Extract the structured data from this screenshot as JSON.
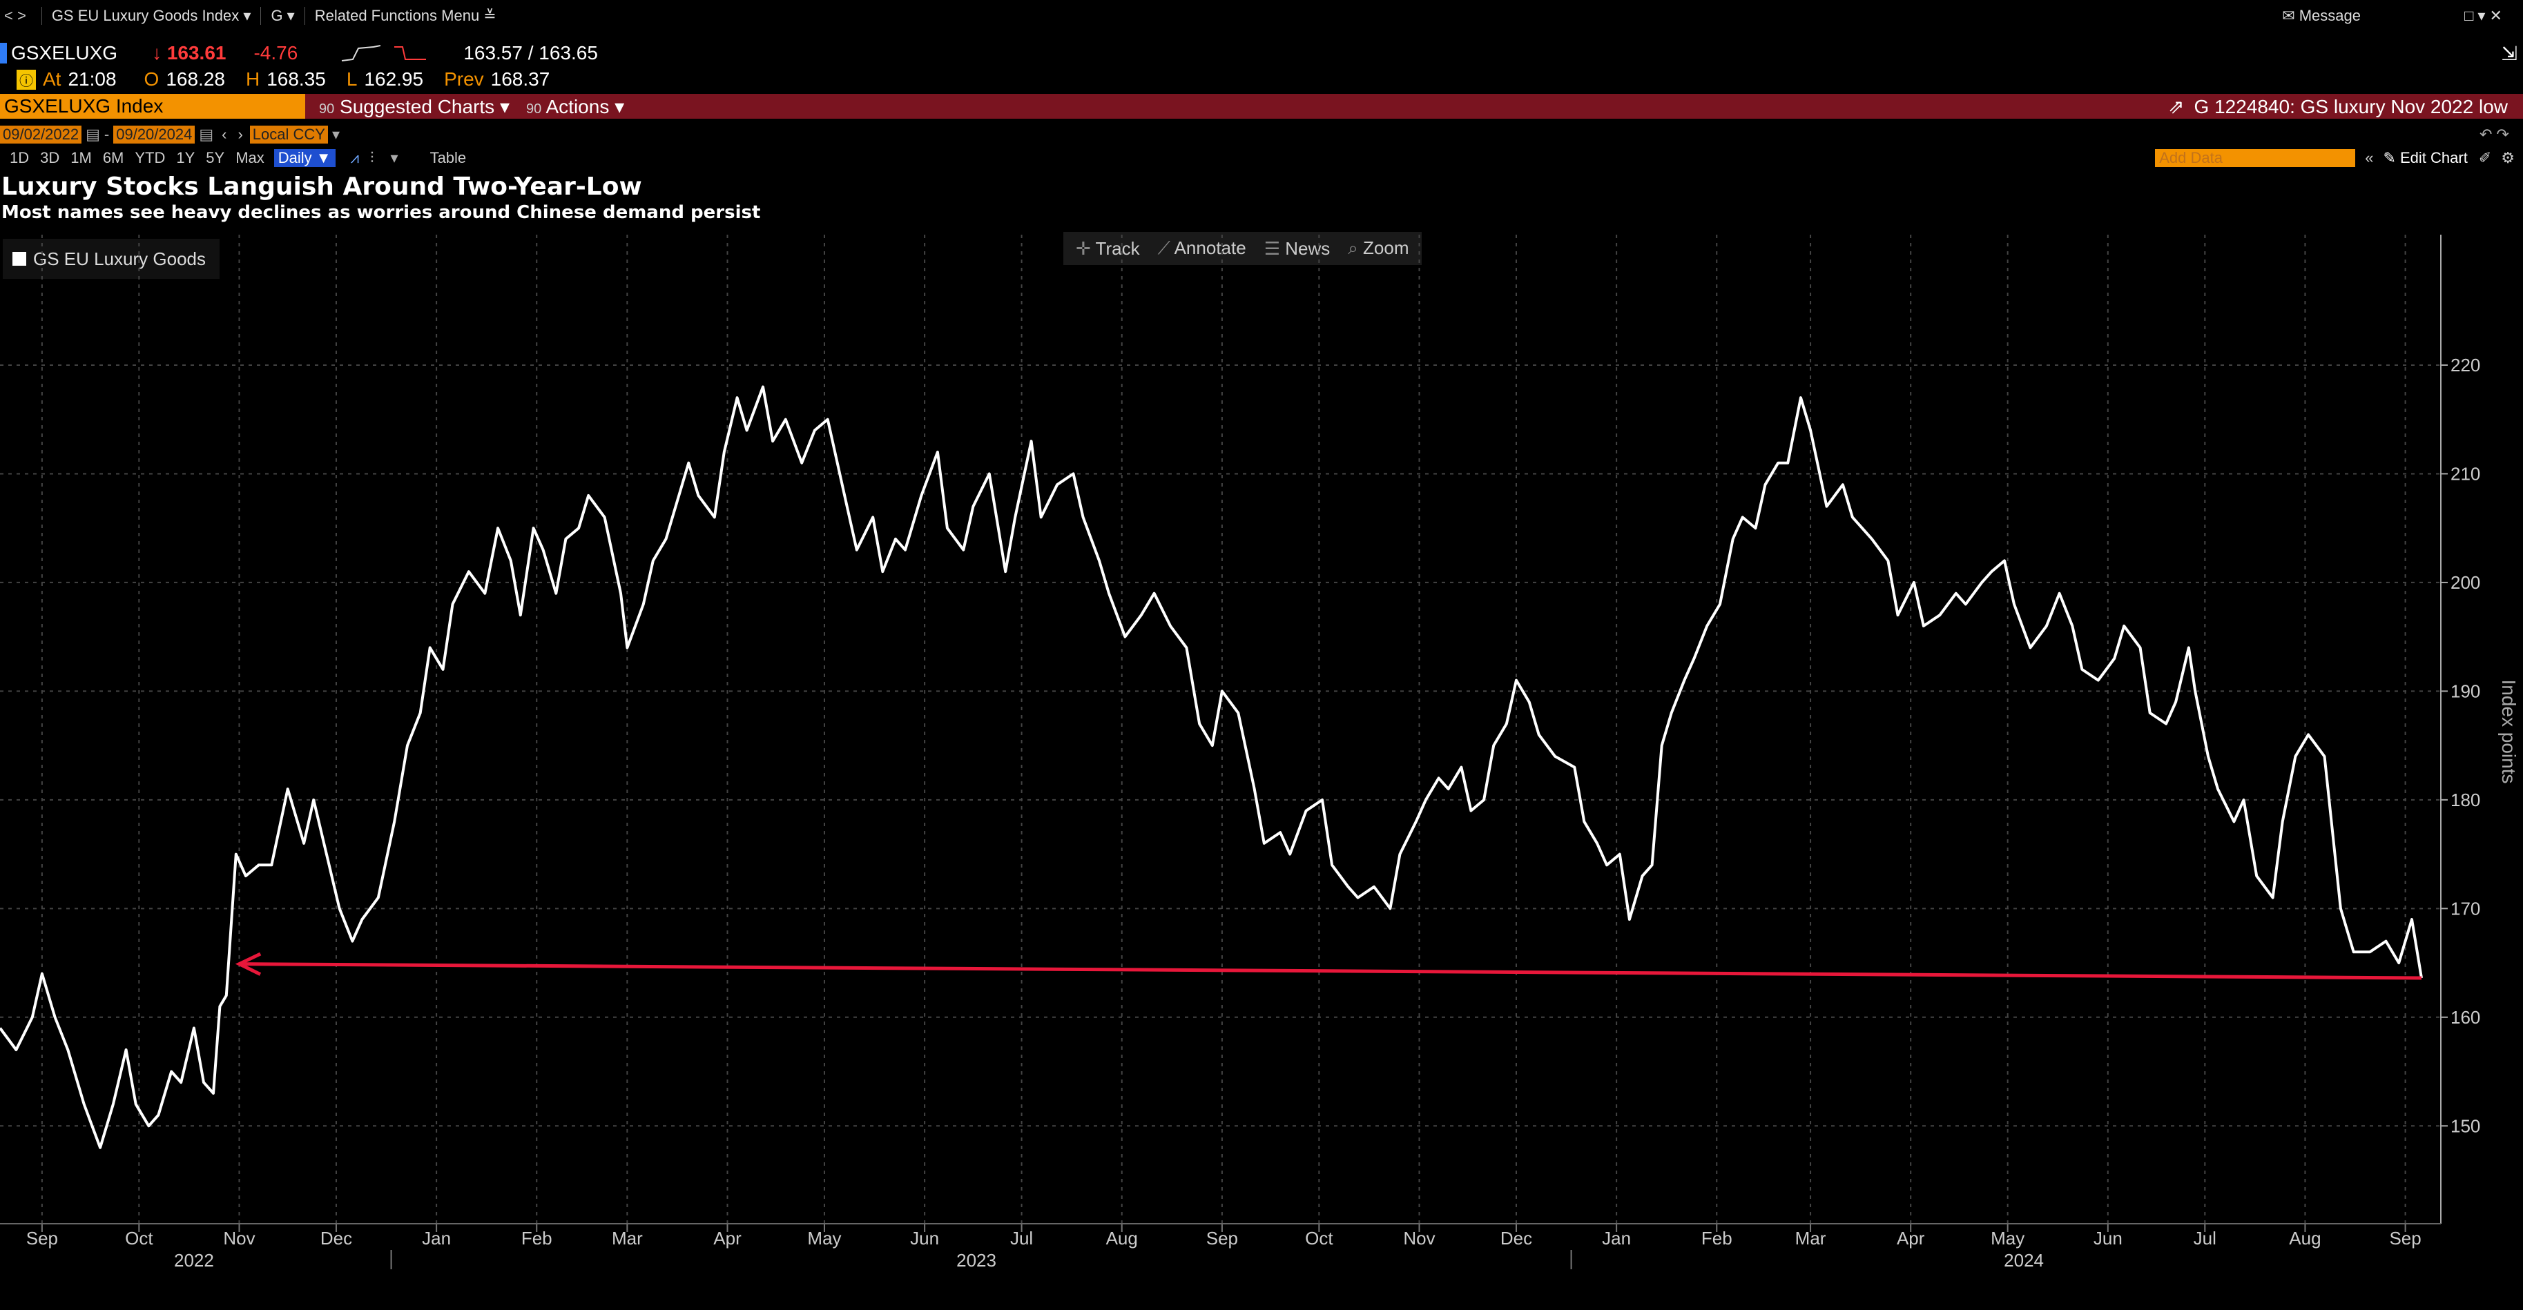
{
  "topbar": {
    "nav": "< >",
    "security": "GS EU Luxury Goods Index ▾",
    "g": "G ▾",
    "related": "Related Functions Menu ≚",
    "message": "Message"
  },
  "quote": {
    "ticker": "GSXELUXG",
    "last": "↓ 163.61",
    "change": "-4.76",
    "bid_ask": "163.57 / 163.65",
    "at_label": "At",
    "time": "21:08",
    "open_label": "O",
    "open": "168.28",
    "high_label": "H",
    "high": "168.35",
    "low_label": "L",
    "low": "162.95",
    "prev_label": "Prev",
    "prev": "168.37"
  },
  "commandbar": {
    "index": "GSXELUXG Index",
    "suggested": "Suggested Charts ▾",
    "actions": "Actions ▾",
    "note": "G 1224840: GS luxury Nov 2022 low"
  },
  "daterow": {
    "start": "09/02/2022",
    "end": "09/20/2024",
    "ccy": "Local CCY"
  },
  "periods": [
    "1D",
    "3D",
    "1M",
    "6M",
    "YTD",
    "1Y",
    "5Y",
    "Max"
  ],
  "period_selected": "Daily ▼",
  "table_label": "Table",
  "add_data": "Add Data",
  "edit_chart": "Edit Chart",
  "tools": {
    "track": "Track",
    "annotate": "Annotate",
    "news": "News",
    "zoom": "Zoom"
  },
  "colors": {
    "line": "#ffffff",
    "arrow": "#e8173a",
    "background": "#000000",
    "cmdbar": "#7a1420",
    "accent": "#f39200"
  },
  "chart_data": {
    "type": "line",
    "title": "Luxury Stocks Languish Around Two-Year-Low",
    "subtitle": "Most names see heavy declines as worries around Chinese demand persist",
    "ylabel": "Index points",
    "ylim": [
      141,
      232
    ],
    "yticks": [
      150,
      160,
      170,
      180,
      190,
      200,
      210,
      220
    ],
    "legend_position": "top-left",
    "grid": true,
    "x_range": [
      "2022-09-02",
      "2024-09-20"
    ],
    "month_ticks": [
      {
        "date": "2022-09-15",
        "label": "Sep"
      },
      {
        "date": "2022-10-15",
        "label": "Oct"
      },
      {
        "date": "2022-11-15",
        "label": "Nov"
      },
      {
        "date": "2022-12-15",
        "label": "Dec"
      },
      {
        "date": "2023-01-15",
        "label": "Jan"
      },
      {
        "date": "2023-02-15",
        "label": "Feb"
      },
      {
        "date": "2023-03-15",
        "label": "Mar"
      },
      {
        "date": "2023-04-15",
        "label": "Apr"
      },
      {
        "date": "2023-05-15",
        "label": "May"
      },
      {
        "date": "2023-06-15",
        "label": "Jun"
      },
      {
        "date": "2023-07-15",
        "label": "Jul"
      },
      {
        "date": "2023-08-15",
        "label": "Aug"
      },
      {
        "date": "2023-09-15",
        "label": "Sep"
      },
      {
        "date": "2023-10-15",
        "label": "Oct"
      },
      {
        "date": "2023-11-15",
        "label": "Nov"
      },
      {
        "date": "2023-12-15",
        "label": "Dec"
      },
      {
        "date": "2024-01-15",
        "label": "Jan"
      },
      {
        "date": "2024-02-15",
        "label": "Feb"
      },
      {
        "date": "2024-03-15",
        "label": "Mar"
      },
      {
        "date": "2024-04-15",
        "label": "Apr"
      },
      {
        "date": "2024-05-15",
        "label": "May"
      },
      {
        "date": "2024-06-15",
        "label": "Jun"
      },
      {
        "date": "2024-07-15",
        "label": "Jul"
      },
      {
        "date": "2024-08-15",
        "label": "Aug"
      },
      {
        "date": "2024-09-15",
        "label": "Sep"
      }
    ],
    "year_labels": [
      {
        "date": "2022-11-01",
        "label": "2022"
      },
      {
        "date": "2023-07-01",
        "label": "2023"
      },
      {
        "date": "2024-05-20",
        "label": "2024"
      }
    ],
    "series": [
      {
        "name": "GS EU Luxury Goods",
        "points": [
          [
            "2022-09-02",
            159
          ],
          [
            "2022-09-07",
            157
          ],
          [
            "2022-09-12",
            160
          ],
          [
            "2022-09-15",
            164
          ],
          [
            "2022-09-19",
            160
          ],
          [
            "2022-09-23",
            157
          ],
          [
            "2022-09-28",
            152
          ],
          [
            "2022-10-03",
            148
          ],
          [
            "2022-10-07",
            152
          ],
          [
            "2022-10-11",
            157
          ],
          [
            "2022-10-14",
            152
          ],
          [
            "2022-10-18",
            150
          ],
          [
            "2022-10-21",
            151
          ],
          [
            "2022-10-25",
            155
          ],
          [
            "2022-10-28",
            154
          ],
          [
            "2022-11-01",
            159
          ],
          [
            "2022-11-04",
            154
          ],
          [
            "2022-11-07",
            153
          ],
          [
            "2022-11-09",
            161
          ],
          [
            "2022-11-11",
            162
          ],
          [
            "2022-11-14",
            175
          ],
          [
            "2022-11-17",
            173
          ],
          [
            "2022-11-21",
            174
          ],
          [
            "2022-11-25",
            174
          ],
          [
            "2022-11-30",
            181
          ],
          [
            "2022-12-05",
            176
          ],
          [
            "2022-12-08",
            180
          ],
          [
            "2022-12-12",
            175
          ],
          [
            "2022-12-16",
            170
          ],
          [
            "2022-12-20",
            167
          ],
          [
            "2022-12-23",
            169
          ],
          [
            "2022-12-28",
            171
          ],
          [
            "2023-01-02",
            178
          ],
          [
            "2023-01-06",
            185
          ],
          [
            "2023-01-10",
            188
          ],
          [
            "2023-01-13",
            194
          ],
          [
            "2023-01-17",
            192
          ],
          [
            "2023-01-20",
            198
          ],
          [
            "2023-01-25",
            201
          ],
          [
            "2023-01-30",
            199
          ],
          [
            "2023-02-03",
            205
          ],
          [
            "2023-02-07",
            202
          ],
          [
            "2023-02-10",
            197
          ],
          [
            "2023-02-14",
            205
          ],
          [
            "2023-02-17",
            203
          ],
          [
            "2023-02-21",
            199
          ],
          [
            "2023-02-24",
            204
          ],
          [
            "2023-02-28",
            205
          ],
          [
            "2023-03-03",
            208
          ],
          [
            "2023-03-08",
            206
          ],
          [
            "2023-03-13",
            199
          ],
          [
            "2023-03-15",
            194
          ],
          [
            "2023-03-20",
            198
          ],
          [
            "2023-03-23",
            202
          ],
          [
            "2023-03-27",
            204
          ],
          [
            "2023-04-03",
            211
          ],
          [
            "2023-04-06",
            208
          ],
          [
            "2023-04-11",
            206
          ],
          [
            "2023-04-14",
            212
          ],
          [
            "2023-04-18",
            217
          ],
          [
            "2023-04-21",
            214
          ],
          [
            "2023-04-26",
            218
          ],
          [
            "2023-04-29",
            213
          ],
          [
            "2023-05-03",
            215
          ],
          [
            "2023-05-08",
            211
          ],
          [
            "2023-05-12",
            214
          ],
          [
            "2023-05-16",
            215
          ],
          [
            "2023-05-19",
            211
          ],
          [
            "2023-05-22",
            207
          ],
          [
            "2023-05-25",
            203
          ],
          [
            "2023-05-30",
            206
          ],
          [
            "2023-06-02",
            201
          ],
          [
            "2023-06-06",
            204
          ],
          [
            "2023-06-09",
            203
          ],
          [
            "2023-06-14",
            208
          ],
          [
            "2023-06-19",
            212
          ],
          [
            "2023-06-22",
            205
          ],
          [
            "2023-06-27",
            203
          ],
          [
            "2023-06-30",
            207
          ],
          [
            "2023-07-05",
            210
          ],
          [
            "2023-07-10",
            201
          ],
          [
            "2023-07-13",
            206
          ],
          [
            "2023-07-18",
            213
          ],
          [
            "2023-07-21",
            206
          ],
          [
            "2023-07-26",
            209
          ],
          [
            "2023-07-31",
            210
          ],
          [
            "2023-08-03",
            206
          ],
          [
            "2023-08-08",
            202
          ],
          [
            "2023-08-11",
            199
          ],
          [
            "2023-08-16",
            195
          ],
          [
            "2023-08-21",
            197
          ],
          [
            "2023-08-25",
            199
          ],
          [
            "2023-08-30",
            196
          ],
          [
            "2023-09-04",
            194
          ],
          [
            "2023-09-08",
            187
          ],
          [
            "2023-09-12",
            185
          ],
          [
            "2023-09-15",
            190
          ],
          [
            "2023-09-20",
            188
          ],
          [
            "2023-09-25",
            181
          ],
          [
            "2023-09-28",
            176
          ],
          [
            "2023-10-03",
            177
          ],
          [
            "2023-10-06",
            175
          ],
          [
            "2023-10-11",
            179
          ],
          [
            "2023-10-16",
            180
          ],
          [
            "2023-10-19",
            174
          ],
          [
            "2023-10-24",
            172
          ],
          [
            "2023-10-27",
            171
          ],
          [
            "2023-11-01",
            172
          ],
          [
            "2023-11-06",
            170
          ],
          [
            "2023-11-09",
            175
          ],
          [
            "2023-11-14",
            178
          ],
          [
            "2023-11-17",
            180
          ],
          [
            "2023-11-21",
            182
          ],
          [
            "2023-11-24",
            181
          ],
          [
            "2023-11-28",
            183
          ],
          [
            "2023-12-01",
            179
          ],
          [
            "2023-12-05",
            180
          ],
          [
            "2023-12-08",
            185
          ],
          [
            "2023-12-12",
            187
          ],
          [
            "2023-12-15",
            191
          ],
          [
            "2023-12-19",
            189
          ],
          [
            "2023-12-22",
            186
          ],
          [
            "2023-12-27",
            184
          ],
          [
            "2024-01-02",
            183
          ],
          [
            "2024-01-05",
            178
          ],
          [
            "2024-01-09",
            176
          ],
          [
            "2024-01-12",
            174
          ],
          [
            "2024-01-16",
            175
          ],
          [
            "2024-01-19",
            169
          ],
          [
            "2024-01-23",
            173
          ],
          [
            "2024-01-26",
            174
          ],
          [
            "2024-01-29",
            185
          ],
          [
            "2024-02-01",
            188
          ],
          [
            "2024-02-05",
            191
          ],
          [
            "2024-02-08",
            193
          ],
          [
            "2024-02-12",
            196
          ],
          [
            "2024-02-16",
            198
          ],
          [
            "2024-02-20",
            204
          ],
          [
            "2024-02-23",
            206
          ],
          [
            "2024-02-27",
            205
          ],
          [
            "2024-03-01",
            209
          ],
          [
            "2024-03-05",
            211
          ],
          [
            "2024-03-08",
            211
          ],
          [
            "2024-03-12",
            217
          ],
          [
            "2024-03-15",
            214
          ],
          [
            "2024-03-20",
            207
          ],
          [
            "2024-03-25",
            209
          ],
          [
            "2024-03-28",
            206
          ],
          [
            "2024-04-03",
            204
          ],
          [
            "2024-04-08",
            202
          ],
          [
            "2024-04-11",
            197
          ],
          [
            "2024-04-16",
            200
          ],
          [
            "2024-04-19",
            196
          ],
          [
            "2024-04-24",
            197
          ],
          [
            "2024-04-29",
            199
          ],
          [
            "2024-05-02",
            198
          ],
          [
            "2024-05-07",
            200
          ],
          [
            "2024-05-10",
            201
          ],
          [
            "2024-05-14",
            202
          ],
          [
            "2024-05-17",
            198
          ],
          [
            "2024-05-22",
            194
          ],
          [
            "2024-05-27",
            196
          ],
          [
            "2024-05-31",
            199
          ],
          [
            "2024-06-04",
            196
          ],
          [
            "2024-06-07",
            192
          ],
          [
            "2024-06-12",
            191
          ],
          [
            "2024-06-17",
            193
          ],
          [
            "2024-06-20",
            196
          ],
          [
            "2024-06-25",
            194
          ],
          [
            "2024-06-28",
            188
          ],
          [
            "2024-07-03",
            187
          ],
          [
            "2024-07-06",
            189
          ],
          [
            "2024-07-10",
            194
          ],
          [
            "2024-07-12",
            190
          ],
          [
            "2024-07-16",
            184
          ],
          [
            "2024-07-19",
            181
          ],
          [
            "2024-07-24",
            178
          ],
          [
            "2024-07-27",
            180
          ],
          [
            "2024-07-31",
            173
          ],
          [
            "2024-08-05",
            171
          ],
          [
            "2024-08-08",
            178
          ],
          [
            "2024-08-12",
            184
          ],
          [
            "2024-08-16",
            186
          ],
          [
            "2024-08-21",
            184
          ],
          [
            "2024-08-26",
            170
          ],
          [
            "2024-08-30",
            166
          ],
          [
            "2024-09-04",
            166
          ],
          [
            "2024-09-09",
            167
          ],
          [
            "2024-09-13",
            165
          ],
          [
            "2024-09-17",
            169
          ],
          [
            "2024-09-20",
            163.61
          ]
        ]
      }
    ],
    "annotations": [
      {
        "type": "arrow",
        "from": {
          "x": "2024-09-20",
          "y": 163.61
        },
        "to": {
          "x": "2022-11-15",
          "y": 164.9
        },
        "color": "#e8173a"
      }
    ]
  }
}
